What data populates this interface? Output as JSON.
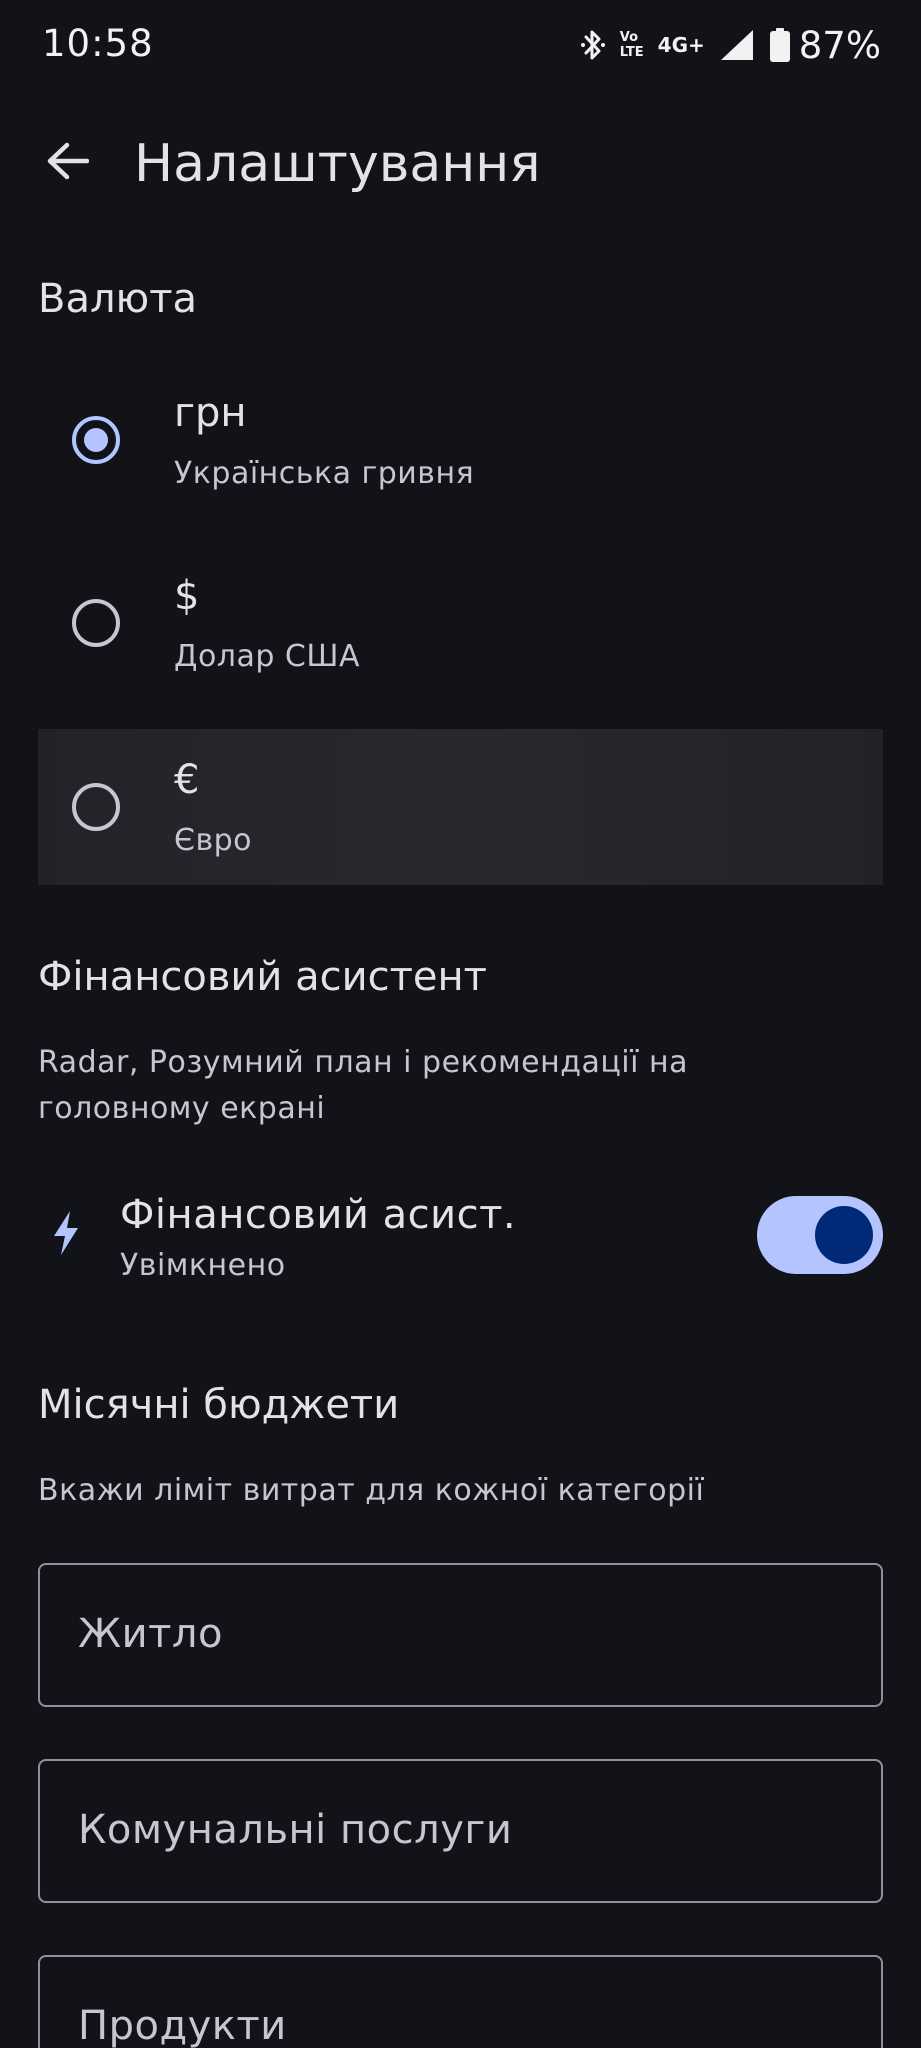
{
  "status_bar": {
    "time": "10:58",
    "bluetooth_icon": "bluetooth-icon",
    "volte_top": "Vo",
    "volte_bottom": "LTE",
    "network": "4G+",
    "signal_icon": "signal-icon",
    "battery_icon": "battery-icon",
    "battery": "87%"
  },
  "app_bar": {
    "back_icon": "arrow-back-icon",
    "title": "Налаштування"
  },
  "currency": {
    "title": "Валюта",
    "options": [
      {
        "symbol": "грн",
        "label": "Українська гривня",
        "selected": true
      },
      {
        "symbol": "$",
        "label": "Долар США",
        "selected": false
      },
      {
        "symbol": "€",
        "label": "Євро",
        "selected": false
      }
    ]
  },
  "assistant": {
    "section_title": "Фінансовий асистент",
    "description": "Radar, Розумний план і рекомендації на головному екрані",
    "icon": "bolt-icon",
    "toggle_title": "Фінансовий асист.",
    "toggle_status": "Увімкнено",
    "enabled": true
  },
  "budgets": {
    "title": "Місячні бюджети",
    "description": "Вкажи ліміт витрат для кожної категорії",
    "fields": [
      {
        "placeholder": "Житло"
      },
      {
        "placeholder": "Комунальні послуги"
      },
      {
        "placeholder": "Продукти"
      }
    ]
  },
  "colors": {
    "background": "#121318",
    "accent": "#b4c4ff",
    "toggle_thumb": "#002a78",
    "text_primary": "#e3e2e9",
    "text_secondary": "#c6c5d0"
  }
}
